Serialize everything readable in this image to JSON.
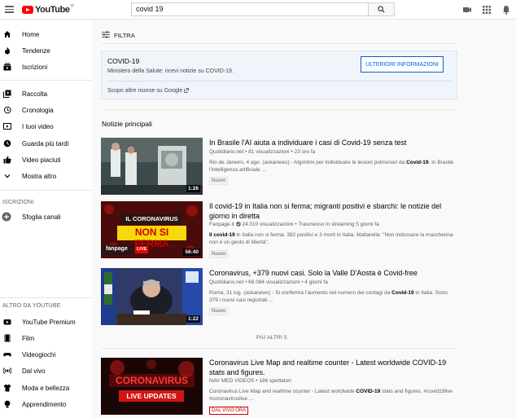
{
  "header": {
    "logo_text": "YouTube",
    "logo_country": "IT",
    "search_value": "covid 19"
  },
  "sidebar": {
    "items_main": [
      {
        "label": "Home",
        "icon": "home-icon"
      },
      {
        "label": "Tendenze",
        "icon": "flame-icon"
      },
      {
        "label": "Iscrizioni",
        "icon": "subscriptions-icon"
      }
    ],
    "items_library": [
      {
        "label": "Raccolta",
        "icon": "library-icon"
      },
      {
        "label": "Cronologia",
        "icon": "history-icon"
      },
      {
        "label": "I tuoi video",
        "icon": "my-videos-icon"
      },
      {
        "label": "Guarda più tardi",
        "icon": "watch-later-icon"
      },
      {
        "label": "Video piaciuti",
        "icon": "thumbs-up-icon"
      },
      {
        "label": "Mostra altro",
        "icon": "chevron-down-icon"
      }
    ],
    "subs_title": "ISCRIZIONI",
    "browse_channels": "Sfoglia canali",
    "more_title": "ALTRO DA YOUTUBE",
    "items_more": [
      {
        "label": "YouTube Premium",
        "icon": "youtube-premium-icon"
      },
      {
        "label": "Film",
        "icon": "film-icon"
      },
      {
        "label": "Videogiochi",
        "icon": "gaming-icon"
      },
      {
        "label": "Dal vivo",
        "icon": "live-icon"
      },
      {
        "label": "Moda e bellezza",
        "icon": "fashion-icon"
      },
      {
        "label": "Apprendimento",
        "icon": "learning-icon"
      }
    ]
  },
  "main": {
    "filter_label": "FILTRA",
    "panel": {
      "title": "COVID-19",
      "subtitle": "Ministero della Salute: ricevi notizie su COVID-19.",
      "button": "ULTERIORI INFORMAZIONI",
      "link": "Scopri altre risorse su Google"
    },
    "section_title": "Notizie principali",
    "news": [
      {
        "title": "In Brasile l'AI aiuta a individuare i casi di Covid-19 senza test",
        "meta": "Quotidiano.net • 81 visualizzazioni • 23 ore fa",
        "desc_pre": "Rio de Janeiro, 4 ago. (askanews) - Algoritmi per individuare le lesioni polmonari da ",
        "desc_bold": "Covid-19",
        "desc_post": ". In Brasile l'intelligenza artificiale ...",
        "badge": "Nuovo",
        "duration": "1:26"
      },
      {
        "title": "Il covid-19 in Italia non si ferma; migranti positivi e sbarchi: le notizie del giorno in diretta",
        "channel": "Fanpage.it",
        "meta_rest": "24.010 visualizzazioni • Trasmesso in streaming 5 giorni fa",
        "desc_bold": "Il covid-19",
        "desc_post": " in Italia non si ferma. 382 positivi e 3 morti in Italia. Mattarella: \"Non indossare la mascherina non è un gesto di libertà\".",
        "badge": "Nuovo",
        "duration": "56:40",
        "thumb_line1": "IL CORONAVIRUS",
        "thumb_line2": "NON SI FERMA",
        "thumb_brand": "fanpage",
        "thumb_live": "LIVE"
      },
      {
        "title": "Coronavirus, +379 nuovi casi. Solo la Valle D'Aosta è Covid-free",
        "meta": "Quotidiano.net • 68.084 visualizzazioni • 4 giorni fa",
        "desc_pre": "Roma, 31 lug. (askanews) - Si conferma l'aumento nel numero dei contagi da ",
        "desc_bold": "Covid-19",
        "desc_post": " in Italia. Sono 379 i nuovi casi registrati ...",
        "badge": "Nuovo",
        "duration": "1:22"
      }
    ],
    "more_label": "PIÙ ALTRI 5",
    "live_video": {
      "title": "Coronavirus Live Map and realtime counter - Latest worldwide COVID-19 stats and figures.",
      "meta": "NAV MED VIDEOS • 186 spettatori",
      "desc_pre": "Coronavirus Live Map and realtime counter - Latest worldwide ",
      "desc_bold": "COVID-19",
      "desc_post": " stats and figures. #covid19live #coronaviruslive ...",
      "badge": "DAL VIVO ORA",
      "thumb_line1": "CORONAVIRUS",
      "thumb_line2": "LIVE UPDATES"
    }
  }
}
